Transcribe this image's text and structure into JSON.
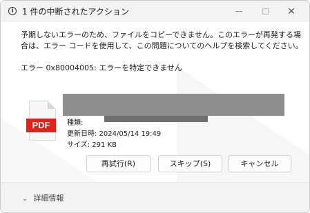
{
  "titlebar": {
    "title": "1 件の中断されたアクション",
    "icon": "info-circle-icon",
    "minimize": "minimize-icon",
    "maximize": "maximize-icon",
    "close": "close-icon"
  },
  "message": "予期しないエラーのため、ファイルをコピーできません。このエラーが再発する場合は、エラー コードを使用して、この問題についてのヘルプを検索してください。",
  "error": "エラー 0x80004005: エラーを特定できません",
  "file": {
    "icon_label": "PDF",
    "type_line": "種類:",
    "modified_line": "更新日時: 2024/05/14 19:49",
    "size_line": "サイズ: 291 KB"
  },
  "buttons": {
    "retry": "再試行(R)",
    "skip": "スキップ(S)",
    "cancel": "キャンセル"
  },
  "footer": {
    "details": "詳細情報"
  },
  "colors": {
    "pdf_red": "#e0231a",
    "titlebar_bg": "#f3f3f3",
    "redaction": "#8d8d8d"
  }
}
